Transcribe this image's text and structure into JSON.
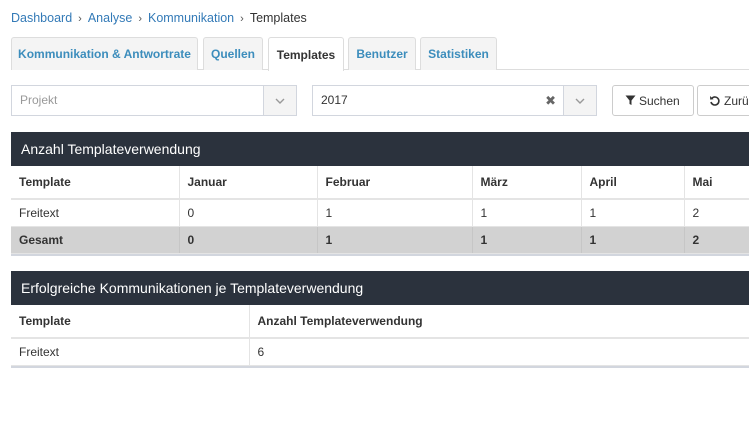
{
  "breadcrumb": {
    "items": [
      "Dashboard",
      "Analyse",
      "Kommunikation"
    ],
    "current": "Templates"
  },
  "tabs": [
    {
      "label": "Kommunikation & Antwortrate",
      "active": false
    },
    {
      "label": "Quellen",
      "active": false
    },
    {
      "label": "Templates",
      "active": true
    },
    {
      "label": "Benutzer",
      "active": false
    },
    {
      "label": "Statistiken",
      "active": false
    }
  ],
  "filters": {
    "project": {
      "value": "",
      "placeholder": "Projekt"
    },
    "year": {
      "value": "2017"
    }
  },
  "buttons": {
    "search": "Suchen",
    "reset": "Zurü"
  },
  "usage_table": {
    "title": "Anzahl Templateverwendung",
    "columns": [
      "Template",
      "Januar",
      "Februar",
      "März",
      "April",
      "Mai"
    ],
    "rows": [
      [
        "Freitext",
        "0",
        "1",
        "1",
        "1",
        "2"
      ]
    ],
    "total": [
      "Gesamt",
      "0",
      "1",
      "1",
      "1",
      "2"
    ]
  },
  "success_table": {
    "title": "Erfolgreiche Kommunikationen je Templateverwendung",
    "columns": [
      "Template",
      "Anzahl Templateverwendung"
    ],
    "rows": [
      [
        "Freitext",
        "6"
      ]
    ]
  },
  "colors": {
    "link": "#337ab7",
    "panel_header": "#2b323d",
    "total_row": "#d2d2d2"
  }
}
